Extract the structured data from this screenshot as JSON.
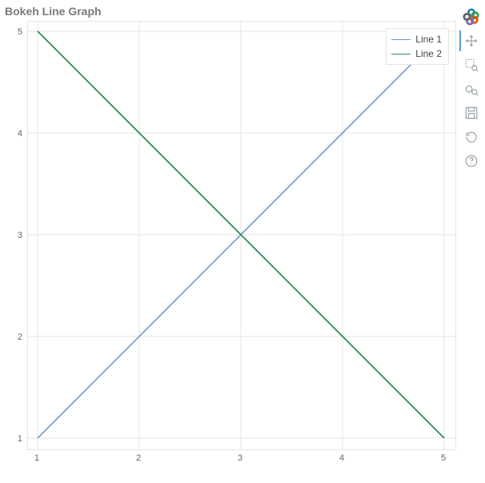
{
  "title": "Bokeh Line Graph",
  "chart_data": {
    "type": "line",
    "x": [
      1,
      2,
      3,
      4,
      5
    ],
    "series": [
      {
        "name": "Line 1",
        "values": [
          1,
          2,
          3,
          4,
          5
        ],
        "color": "#6b8fbf"
      },
      {
        "name": "Line 2",
        "values": [
          5,
          4,
          3,
          2,
          1
        ],
        "color": "#2e8b57"
      }
    ],
    "xlim": [
      1,
      5
    ],
    "ylim": [
      1,
      5
    ],
    "xticks": [
      1,
      2,
      3,
      4,
      5
    ],
    "yticks": [
      1,
      2,
      3,
      4,
      5
    ],
    "grid": true
  },
  "legend": {
    "item0": "Line 1",
    "item1": "Line 2"
  },
  "xticks": {
    "t0": "1",
    "t1": "2",
    "t2": "3",
    "t3": "4",
    "t4": "5"
  },
  "yticks": {
    "t0": "1",
    "t1": "2",
    "t2": "3",
    "t3": "4",
    "t4": "5"
  },
  "toolbar": {
    "logo": "bokeh-logo",
    "pan": "Pan",
    "box_zoom": "Box Zoom",
    "wheel_zoom": "Wheel Zoom",
    "save": "Save",
    "reset": "Reset",
    "help": "Help"
  }
}
